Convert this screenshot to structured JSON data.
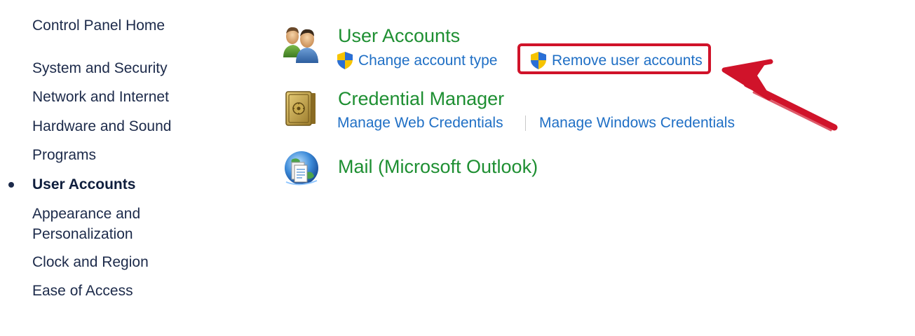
{
  "nav": {
    "home": "Control Panel Home",
    "items": [
      {
        "label": "System and Security"
      },
      {
        "label": "Network and Internet"
      },
      {
        "label": "Hardware and Sound"
      },
      {
        "label": "Programs"
      },
      {
        "label": "User Accounts",
        "active": true
      },
      {
        "label": "Appearance and"
      },
      {
        "label": "Personalization"
      },
      {
        "label": "Clock and Region"
      },
      {
        "label": "Ease of Access"
      }
    ]
  },
  "categories": {
    "user_accounts": {
      "title": "User Accounts",
      "icon": "users-icon",
      "links": {
        "change_type": "Change account type",
        "remove": "Remove user accounts"
      }
    },
    "credential_manager": {
      "title": "Credential Manager",
      "icon": "safe-icon",
      "links": {
        "web": "Manage Web Credentials",
        "windows": "Manage Windows Credentials"
      }
    },
    "mail": {
      "title": "Mail (Microsoft Outlook)",
      "icon": "mail-globe-icon"
    }
  },
  "colors": {
    "category_title": "#1e8f32",
    "link": "#1f6fc5",
    "annotation": "#d0132a",
    "nav_text": "#1c2a4a"
  }
}
